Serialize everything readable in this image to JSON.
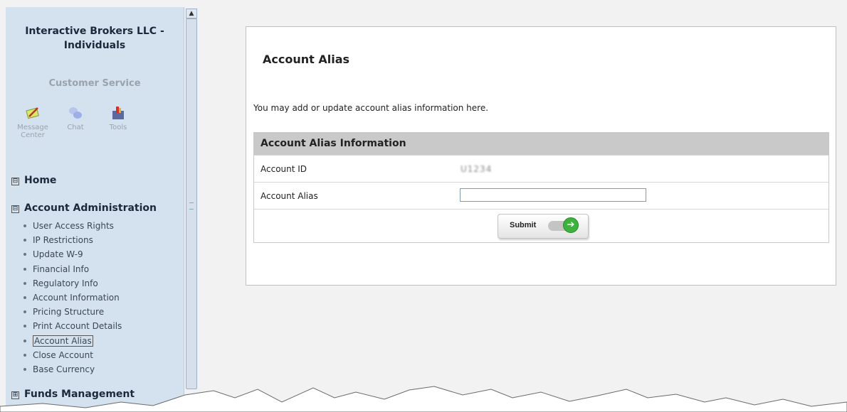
{
  "sidebar": {
    "org_line1": "Interactive Brokers LLC -",
    "org_line2": "Individuals",
    "customer_service": "Customer Service",
    "tools": [
      {
        "label_line1": "Message",
        "label_line2": "Center",
        "icon": "message-center-icon"
      },
      {
        "label_line1": "Chat",
        "label_line2": "",
        "icon": "chat-icon"
      },
      {
        "label_line1": "Tools",
        "label_line2": "",
        "icon": "tools-icon"
      }
    ],
    "home": "Home",
    "account_admin": "Account Administration",
    "admin_items": [
      "User Access Rights",
      "IP Restrictions",
      "Update W-9",
      "Financial Info",
      "Regulatory Info",
      "Account Information",
      "Pricing Structure",
      "Print Account Details",
      "Account Alias",
      "Close Account",
      "Base Currency"
    ],
    "active_item": "Account Alias",
    "funds": "Funds Management",
    "expanded_symbol": "⊟",
    "collapsed_symbol": "⊞"
  },
  "main": {
    "title": "Account Alias",
    "description": "You may add or update account alias information here.",
    "table_header": "Account Alias Information",
    "account_id_label": "Account ID",
    "account_id_value": "U1234",
    "alias_label": "Account Alias",
    "alias_value": "",
    "submit_label": "Submit"
  },
  "colors": {
    "sidebar_bg": "#d4e2f0",
    "header_bg": "#c9c9c9",
    "go_green": "#3db33d"
  }
}
